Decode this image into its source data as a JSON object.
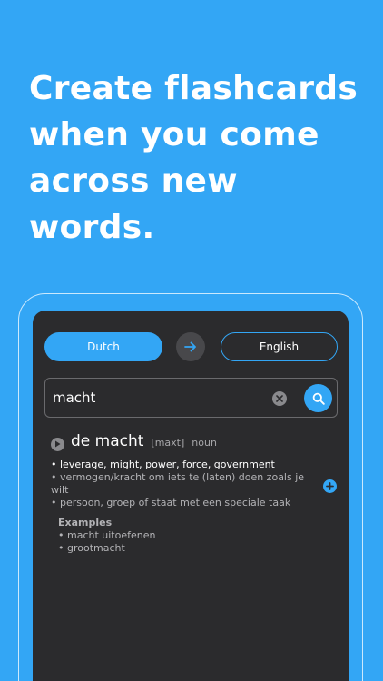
{
  "headline": {
    "line1": "Create flashcards",
    "line2": "when you come",
    "line3": "across new words."
  },
  "translator": {
    "source_language": "Dutch",
    "target_language": "English",
    "swap_icon": "arrow-right-icon"
  },
  "search": {
    "value": "macht",
    "clear_icon": "clear-icon",
    "search_icon": "search-icon"
  },
  "result": {
    "play_icon": "play-icon",
    "headword": "de macht",
    "phonetic": "[maxt]",
    "part_of_speech": "noun",
    "senses": [
      "• leverage, might, power, force, government",
      "• vermogen/kracht om iets te (laten) doen zoals je wilt",
      "• persoon, groep of staat met een speciale taak"
    ],
    "examples_title": "Examples",
    "examples": [
      "• macht uitoefenen",
      "• grootmacht"
    ],
    "add_icon": "add-flashcard-icon"
  },
  "colors": {
    "brand_blue": "#33a6f5",
    "screen_background": "#2b2b2d",
    "secondary_text": "#b3b3b6"
  }
}
